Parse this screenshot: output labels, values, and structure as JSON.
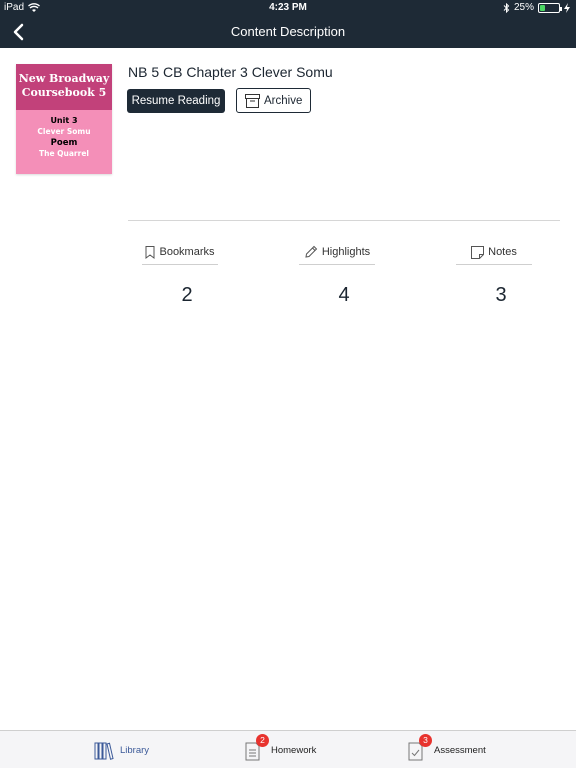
{
  "status_bar": {
    "device": "iPad",
    "time": "4:23 PM",
    "battery": "25%",
    "battery_level": 0.25
  },
  "nav": {
    "title": "Content Description"
  },
  "cover": {
    "title_line1": "New Broadway",
    "title_line2": "Coursebook 5",
    "unit": "Unit 3",
    "story": "Clever Somu",
    "section": "Poem",
    "poem": "The Quarrel"
  },
  "book": {
    "title": "NB 5 CB Chapter 3 Clever Somu",
    "resume_label": "Resume Reading",
    "archive_label": "Archive"
  },
  "stats": [
    {
      "label": "Bookmarks",
      "value": "2",
      "icon": "bookmark-icon"
    },
    {
      "label": "Highlights",
      "value": "4",
      "icon": "pencil-icon"
    },
    {
      "label": "Notes",
      "value": "3",
      "icon": "note-icon"
    }
  ],
  "tabs": [
    {
      "label": "Library",
      "icon": "library-icon",
      "badge": ""
    },
    {
      "label": "Homework",
      "icon": "homework-icon",
      "badge": "2"
    },
    {
      "label": "Assessment",
      "icon": "assessment-icon",
      "badge": "3"
    }
  ],
  "colors": {
    "dark": "#1e2a36",
    "cover_top": "#c2417a",
    "cover_bottom": "#f48fb8",
    "badge": "#e8332e",
    "active_tab": "#3b5998"
  }
}
